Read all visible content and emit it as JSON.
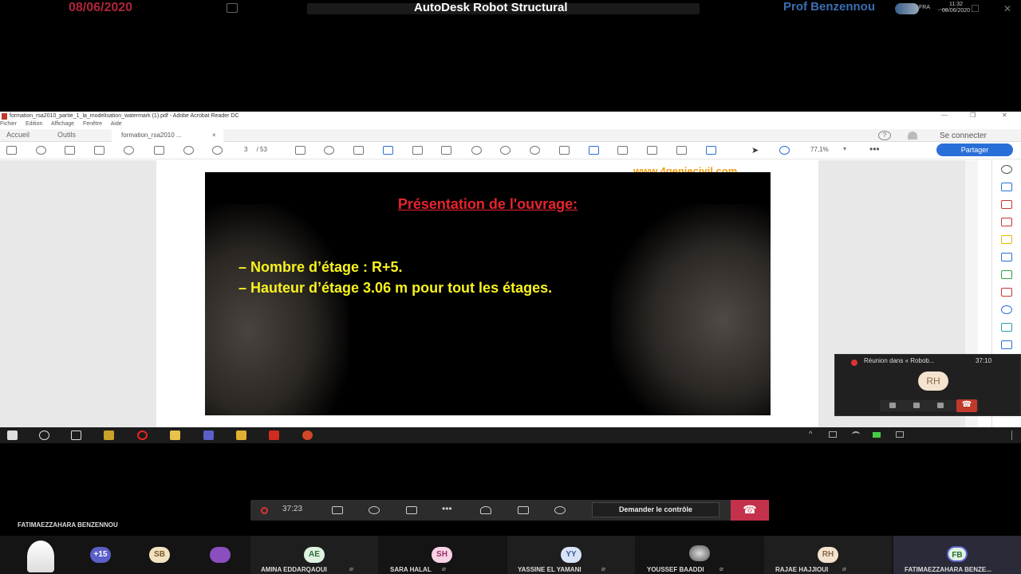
{
  "top": {
    "date": "08/06/2020",
    "title": "AutoDesk Robot Structural",
    "presenter": "Prof Benzennou"
  },
  "acrobat": {
    "window_title": "formation_rsa2010_partie_1_la_modelisation_watermark (1).pdf - Adobe Acrobat Reader DC",
    "menu": [
      "Fichier",
      "Edition",
      "Affichage",
      "Fenêtre",
      "Aide"
    ],
    "tabs": {
      "home": "Accueil",
      "tools": "Outils",
      "doc": "formation_rsa2010 ..."
    },
    "help": "?",
    "connect": "Se connecter",
    "page_current": "3",
    "page_total": "/ 53",
    "zoom": "77,1%",
    "share": "Partager"
  },
  "slide": {
    "watermark": "www.4geniecivil.com",
    "title": "Présentation de l'ouvrage:",
    "line1": "– Nombre d’étage : R+5.",
    "line2": "– Hauteur d’étage 3.06 m pour tout les étages."
  },
  "mini_window": {
    "title": "Réunion dans « Robob...",
    "time": "37:10",
    "avatar": "RH"
  },
  "taskbar": {
    "lang": "FRA",
    "time": "11:32",
    "date": "08/06/2020"
  },
  "meeting_bar": {
    "elapsed": "37:23",
    "request_control": "Demander le contrôle"
  },
  "presenter_name": "FATIMAEZZAHARA BENZENNOU",
  "participants": [
    {
      "initials": "+15",
      "name": ""
    },
    {
      "initials": "SB",
      "name": ""
    },
    {
      "initials": "AE",
      "name": "AMINA EDDARQAOUI"
    },
    {
      "initials": "SH",
      "name": "SARA HALAL"
    },
    {
      "initials": "YY",
      "name": "YASSINE EL YAMANI"
    },
    {
      "initials": "",
      "name": "YOUSSEF BAADDI"
    },
    {
      "initials": "RH",
      "name": "RAJAE HAJJIOUI"
    },
    {
      "initials": "FB",
      "name": "FATIMAEZZAHARA BENZE..."
    }
  ],
  "colors": {
    "accent_blue": "#2a6fd8",
    "hangup_red": "#c4314b",
    "slide_title_red": "#e8232e",
    "slide_text_yellow": "#f7f21f"
  }
}
